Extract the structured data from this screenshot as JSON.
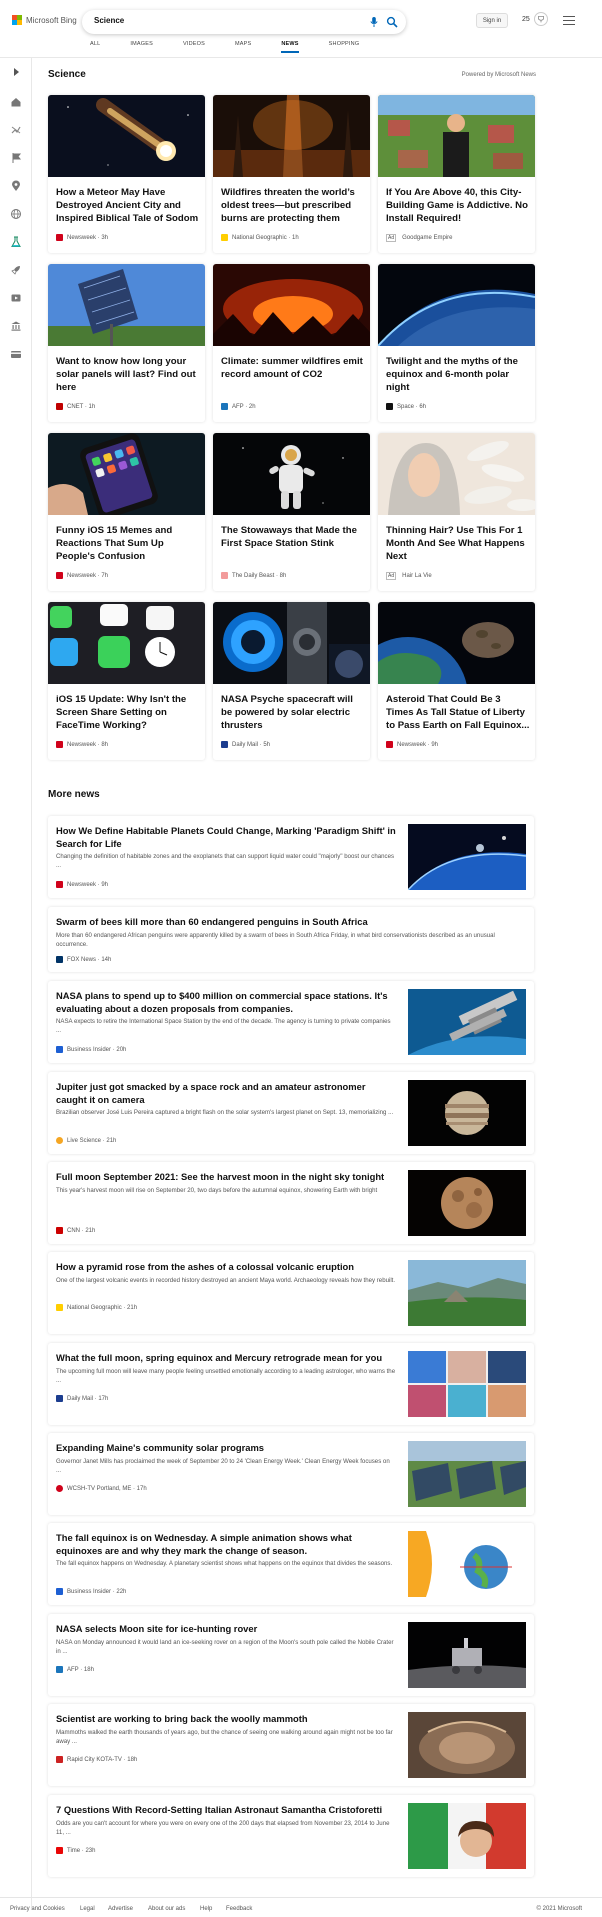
{
  "header": {
    "logo_text": "Microsoft Bing",
    "search_value": "Science",
    "signin_label": "Sign in",
    "points": "25",
    "scopes": [
      "ALL",
      "IMAGES",
      "VIDEOS",
      "MAPS",
      "NEWS",
      "SHOPPING"
    ],
    "active_scope": "NEWS"
  },
  "section": {
    "title": "Science",
    "powered_by": "Powered by Microsoft News"
  },
  "cards": [
    {
      "title": "How a Meteor May Have Destroyed Ancient City and Inspired Biblical Tale of Sodom",
      "source": "Newsweek · 3h",
      "logo_color": "#d0021b",
      "ad": false
    },
    {
      "title": "Wildfires threaten the world’s oldest trees—but prescribed burns are protecting them",
      "source": "National Geographic · 1h",
      "logo_color": "#ffce00",
      "ad": false
    },
    {
      "title": "If You Are Above 40, this City-Building Game is Addictive. No Install Required!",
      "source": "Goodgame Empire",
      "logo_color": "",
      "ad": true,
      "ad_label": "Ad"
    },
    {
      "title": "Want to know how long your solar panels will last? Find out here",
      "source": "CNET · 1h",
      "logo_color": "#c00000",
      "ad": false
    },
    {
      "title": "Climate: summer wildfires emit record amount of CO2",
      "source": "AFP · 2h",
      "logo_color": "#1b75bb",
      "ad": false
    },
    {
      "title": "Twilight and the myths of the equinox and 6-month polar night",
      "source": "Space · 6h",
      "logo_color": "#111111",
      "ad": false
    },
    {
      "title": "Funny iOS 15 Memes and Reactions That Sum Up People's Confusion",
      "source": "Newsweek · 7h",
      "logo_color": "#d0021b",
      "ad": false
    },
    {
      "title": "The Stowaways that Made the First Space Station Stink",
      "source": "The Daily Beast · 8h",
      "logo_color": "#f29b9b",
      "ad": false
    },
    {
      "title": "Thinning Hair? Use This For 1 Month And See What Happens Next",
      "source": "Hair La Vie",
      "logo_color": "",
      "ad": true,
      "ad_label": "Ad"
    },
    {
      "title": "iOS 15 Update: Why Isn't the Screen Share Setting on FaceTime Working?",
      "source": "Newsweek · 8h",
      "logo_color": "#d0021b",
      "ad": false
    },
    {
      "title": "NASA Psyche spacecraft will be powered by solar electric thrusters",
      "source": "Daily Mail · 5h",
      "logo_color": "#1c3d8f",
      "ad": false
    },
    {
      "title": "Asteroid That Could Be 3 Times As Tall Statue of Liberty to Pass Earth on Fall Equinox...",
      "source": "Newsweek · 9h",
      "logo_color": "#d0021b",
      "ad": false
    }
  ],
  "more_news_title": "More news",
  "news": [
    {
      "title": "How We Define Habitable Planets Could Change, Marking 'Paradigm Shift' in Search for Life",
      "snippet": "Changing the definition of habitable zones and the exoplanets that can support liquid water could \"majorly\" boost our chances ...",
      "source": "Newsweek · 9h",
      "logo_color": "#d0021b",
      "has_image": true
    },
    {
      "title": "Swarm of bees kill more than 60 endangered penguins in South Africa",
      "snippet": "More than 60 endangered African penguins were apparently killed by a swarm of bees in South Africa Friday, in what bird conservationists described as an unusual occurrence.",
      "source": "FOX News · 14h",
      "logo_color": "#003366",
      "has_image": false
    },
    {
      "title": "NASA plans to spend up to $400 million on commercial space stations. It's evaluating about a dozen proposals from companies.",
      "snippet": "NASA expects to retire the International Space Station by the end of the decade. The agency is turning to private companies ...",
      "source": "Business Insider · 20h",
      "logo_color": "#1d5fd3",
      "has_image": true
    },
    {
      "title": "Jupiter just got smacked by a space rock and an amateur astronomer caught it on camera",
      "snippet": "Brazilian observer José Luis Pereira captured a bright flash on the solar system's largest planet on Sept. 13, memorializing ...",
      "source": "Live Science · 21h",
      "logo_color": "#f5a623",
      "has_image": true
    },
    {
      "title": "Full moon September 2021: See the harvest moon in the night sky tonight",
      "snippet": "This year's harvest moon will rise on September 20, two days before the autumnal equinox, showering Earth with bright",
      "source": "CNN · 21h",
      "logo_color": "#cc0000",
      "has_image": true
    },
    {
      "title": "How a pyramid rose from the ashes of a colossal volcanic eruption",
      "snippet": "One of the largest volcanic events in recorded history destroyed an ancient Maya world. Archaeology reveals how they rebuilt.",
      "source": "National Geographic · 21h",
      "logo_color": "#ffce00",
      "has_image": true
    },
    {
      "title": "What the full moon, spring equinox and Mercury retrograde mean for you",
      "snippet": "The upcoming full moon will leave many people feeling unsettled emotionally according to a leading astrologer, who warns the ...",
      "source": "Daily Mail · 17h",
      "logo_color": "#1c3d8f",
      "has_image": true
    },
    {
      "title": "Expanding Maine's community solar programs",
      "snippet": "Governor Janet Mills has proclaimed the week of September 20 to 24 'Clean Energy Week.' Clean Energy Week focuses on ...",
      "source": "WCSH-TV Portland, ME · 17h",
      "logo_color": "#d0021b",
      "has_image": true
    },
    {
      "title": "The fall equinox is on Wednesday. A simple animation shows what equinoxes are and why they mark the change of season.",
      "snippet": "The fall equinox happens on Wednesday. A planetary scientist shows what happens on the equinox that divides the seasons.",
      "source": "Business Insider · 22h",
      "logo_color": "#1d5fd3",
      "has_image": true
    },
    {
      "title": "NASA selects Moon site for ice-hunting rover",
      "snippet": "NASA on Monday announced it would land an ice-seeking rover on a region of the Moon's south pole called the Nobile Crater in ...",
      "source": "AFP · 18h",
      "logo_color": "#1b75bb",
      "has_image": true
    },
    {
      "title": "Scientist are working to bring back the woolly mammoth",
      "snippet": "Mammoths walked the earth thousands of years ago, but the chance of seeing one walking around again might not be too far away ...",
      "source": "Rapid City KOTA-TV · 18h",
      "logo_color": "#cc2222",
      "has_image": true
    },
    {
      "title": "7 Questions With Record-Setting Italian Astronaut Samantha Cristoforetti",
      "snippet": "Odds are you can't account for where you were on every one of the 200 days that elapsed from November 23, 2014 to June 11, ...",
      "source": "Time · 23h",
      "logo_color": "#e90606",
      "has_image": true
    }
  ],
  "footer": {
    "links": [
      "Privacy and Cookies",
      "Legal",
      "Advertise",
      "About our ads",
      "Help",
      "Feedback"
    ],
    "copyright": "© 2021 Microsoft"
  }
}
